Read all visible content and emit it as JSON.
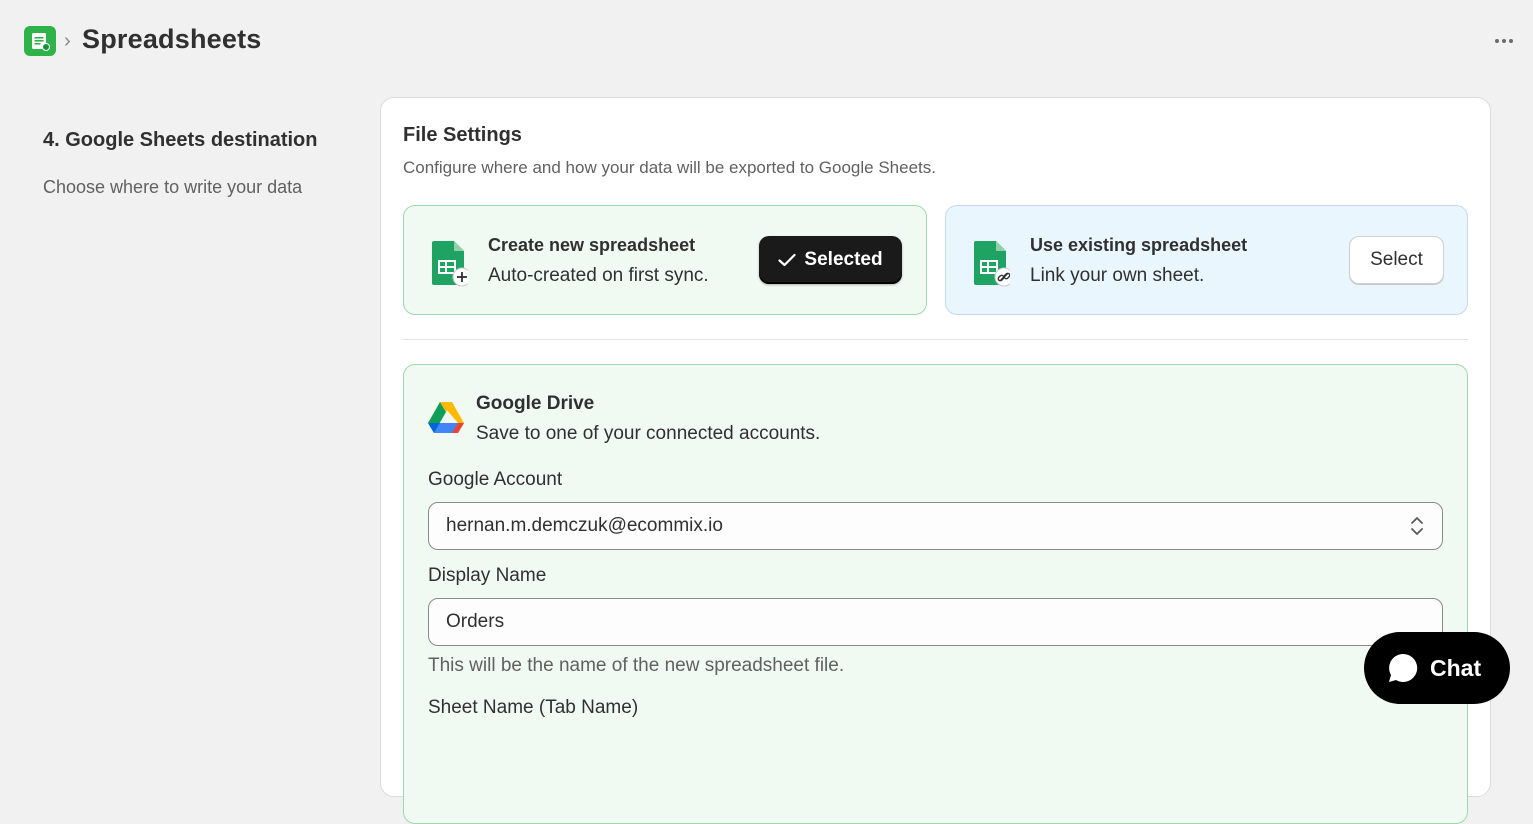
{
  "header": {
    "breadcrumb_separator": "›",
    "title": "Spreadsheets",
    "app_icon": "spreadsheet-app-icon",
    "more_icon": "ellipsis-icon"
  },
  "sidebar": {
    "step_title": "4. Google Sheets destination",
    "step_description": "Choose where to write your data"
  },
  "file_settings": {
    "title": "File Settings",
    "subtitle": "Configure where and how your data will be exported to Google Sheets.",
    "options": [
      {
        "title": "Create new spreadsheet",
        "description": "Auto-created on first sync.",
        "button_label": "Selected",
        "selected": true,
        "icon": "sheet-plus-icon"
      },
      {
        "title": "Use existing spreadsheet",
        "description": "Link your own sheet.",
        "button_label": "Select",
        "selected": false,
        "icon": "sheet-link-icon"
      }
    ]
  },
  "drive": {
    "title": "Google Drive",
    "description": "Save to one of your connected accounts.",
    "account_label": "Google Account",
    "account_value": "hernan.m.demczuk@ecommix.io",
    "display_name_label": "Display Name",
    "display_name_value": "Orders",
    "display_name_help": "This will be the name of the new spreadsheet file.",
    "sheet_name_label": "Sheet Name (Tab Name)"
  },
  "chat": {
    "label": "Chat"
  },
  "colors": {
    "accent_green": "#2eb34a",
    "selected_bg": "#f0faf2",
    "existing_bg": "#eaf6fd",
    "dark_button": "#1a1a1a"
  }
}
